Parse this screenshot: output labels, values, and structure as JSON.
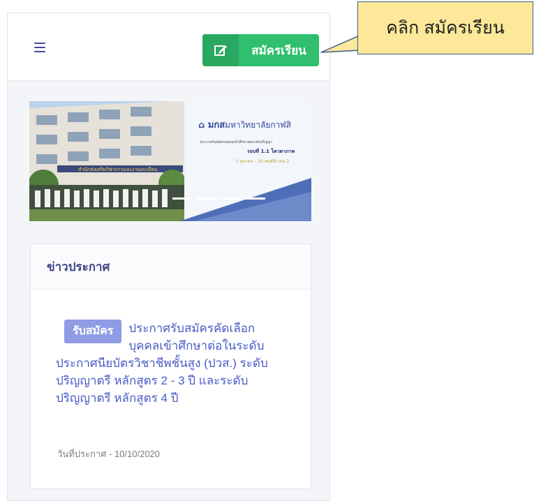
{
  "header": {
    "apply_button_label": "สมัครเรียน",
    "apply_icon": "edit-icon"
  },
  "banner": {
    "university_name": "มหาวิทยาลัยกาฬสิ",
    "subtitle": "ประกาศรับสมัครบุคคลเข้าศึกษาต่อระดับปริญญา",
    "round_label": "รอบที่ 1.1 โควตาภาค",
    "date_range": "5 ตุลาคม – 20 พฤศจิกายน 2",
    "building_sign": "สำนักส่งเสริมวิชาการและงานทะเบียน"
  },
  "news": {
    "section_title": "ข่าวประกาศ",
    "badge": "รับสมัคร",
    "title": "ประกาศรับสมัครคัดเลือกบุคคลเข้าศึกษาต่อในระดับประกาศนียบัตรวิชาชีพชั้นสูง (ปวส.) ระดับปริญญาตรี หลักสูตร 2 - 3 ปี และระดับปริญญาตรี หลักสูตร 4 ปี",
    "date": "วันที่ประกาศ - 10/10/2020"
  },
  "callout": {
    "text": "คลิก สมัครเรียน"
  },
  "colors": {
    "button_green": "#2fbf6e",
    "button_icon_green": "#28a860",
    "link_blue": "#4a5bc4",
    "badge_purple": "#8f9be4",
    "callout_yellow": "#fde89a",
    "callout_border": "#3b5d8f"
  }
}
